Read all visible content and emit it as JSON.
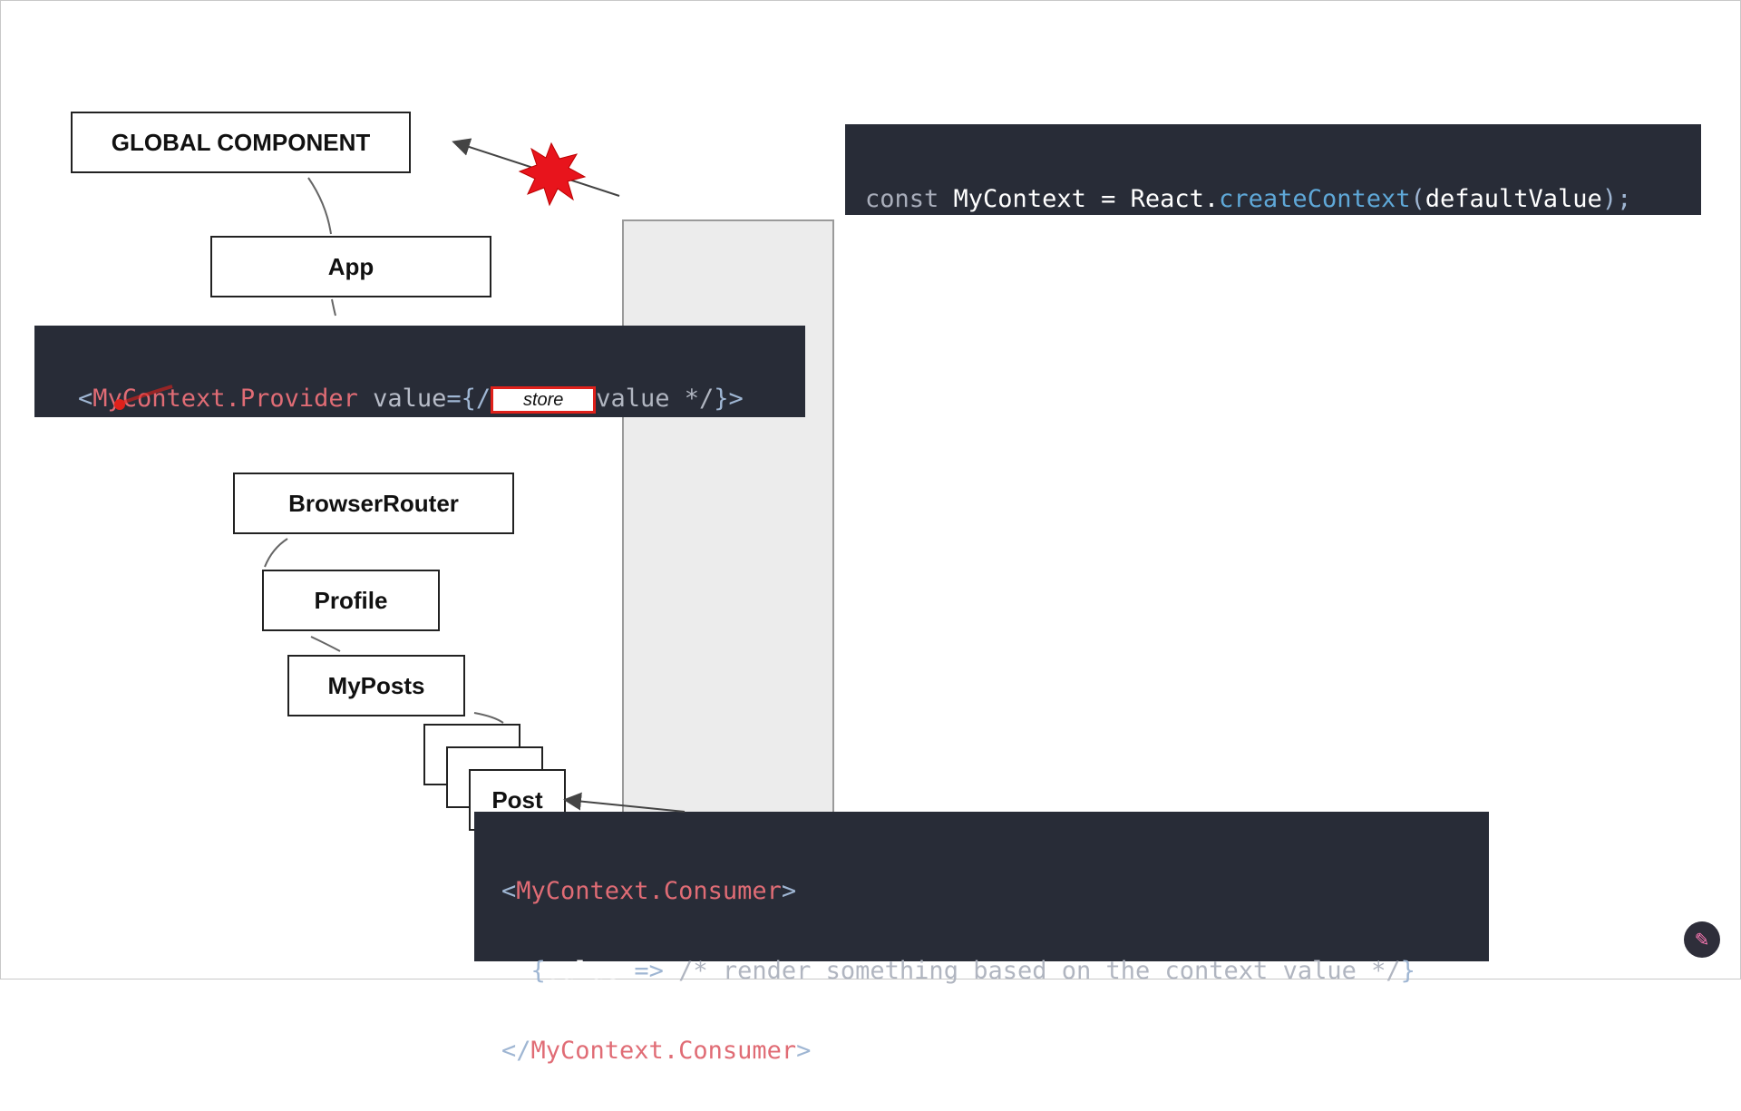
{
  "nodes": {
    "global_component": "GLOBAL COMPONENT",
    "app": "App",
    "browser_router": "BrowserRouter",
    "profile": "Profile",
    "my_posts": "MyPosts",
    "post": "Post"
  },
  "code_create": {
    "keyword": "const",
    "name": " MyContext = React",
    "dot": ".",
    "fn": "createContext",
    "open": "(",
    "arg": "defaultValue",
    "close": ");"
  },
  "code_provider": {
    "open": "<",
    "tag": "MyContext.Provider",
    "attr": " value",
    "eq": "={/",
    "store_label": "store",
    "rest": "value */",
    "close": "}>"
  },
  "code_consumer": {
    "line1_open": "<",
    "line1_tag": "MyContext.Consumer",
    "line1_close": ">",
    "line2_indent": "  {",
    "line2_value": "value",
    "line2_arrow": " => ",
    "line2_comment": "/* render something based on the context value */",
    "line2_close": "}",
    "line3_open": "</",
    "line3_tag": "MyContext.Consumer",
    "line3_close": ">"
  },
  "colors": {
    "code_bg": "#282c37",
    "tag": "#e06c75",
    "function": "#5fa8d8",
    "highlight_red": "#e0211b",
    "panel_gray": "#ececec"
  },
  "icons": [
    "explosion-icon",
    "laser-pointer-icon",
    "channel-avatar-icon"
  ]
}
